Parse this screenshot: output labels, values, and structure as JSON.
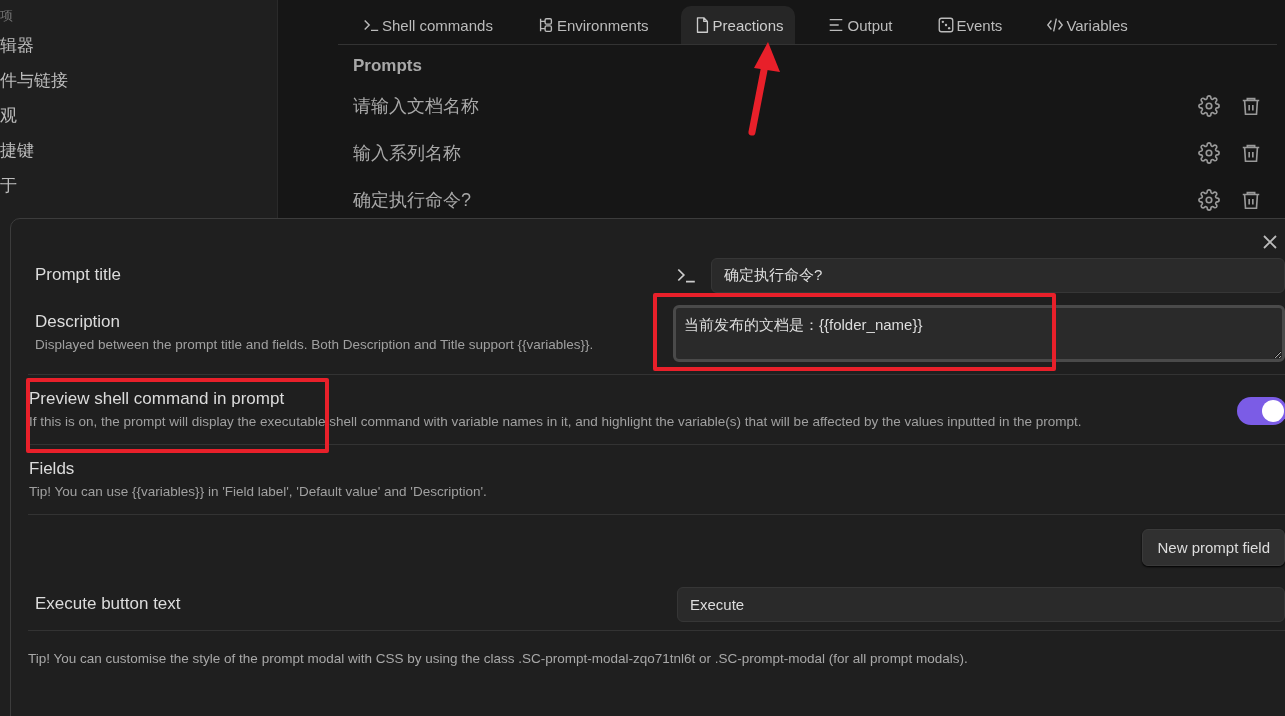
{
  "sidebar": {
    "items": [
      {
        "kind": "header",
        "label": "项"
      },
      {
        "kind": "item",
        "label": "辑器"
      },
      {
        "kind": "item",
        "label": "件与链接"
      },
      {
        "kind": "item",
        "label": "观"
      },
      {
        "kind": "item",
        "label": "捷键"
      },
      {
        "kind": "item",
        "label": "于"
      }
    ]
  },
  "tabs": [
    {
      "label": "Shell commands",
      "selected": false
    },
    {
      "label": "Environments",
      "selected": false
    },
    {
      "label": "Preactions",
      "selected": true
    },
    {
      "label": "Output",
      "selected": false
    },
    {
      "label": "Events",
      "selected": false
    },
    {
      "label": "Variables",
      "selected": false
    }
  ],
  "prompts": {
    "heading": "Prompts",
    "items": [
      {
        "title": "请输入文档名称"
      },
      {
        "title": "输入系列名称"
      },
      {
        "title": "确定执行命令?"
      }
    ]
  },
  "modal": {
    "settings": [
      {
        "kind": "text",
        "name": "Prompt title",
        "value": "确定执行命令?"
      },
      {
        "kind": "textarea",
        "name": "Description",
        "description": "Displayed between the prompt title and fields. Both Description and Title support {{variables}}.",
        "value": "当前发布的文档是：{{folder_name}}"
      },
      {
        "kind": "toggle",
        "name": "Preview shell command in prompt",
        "description": "If this is on, the prompt will display the executable shell command with variable names in it, and highlight the variable(s) that will be affected by the values inputted in the prompt.",
        "on": true
      },
      {
        "kind": "heading",
        "name": "Fields",
        "description": "Tip! You can use {{variables}} in 'Field label', 'Default value' and 'Description'."
      },
      {
        "kind": "button",
        "label": "New prompt field"
      },
      {
        "kind": "text",
        "name": "Execute button text",
        "value": "Execute"
      }
    ],
    "footer_tip": "Tip! You can customise the style of the prompt modal with CSS by using the class .SC-prompt-modal-zqo71tnl6t or .SC-prompt-modal (for all prompt modals)."
  }
}
